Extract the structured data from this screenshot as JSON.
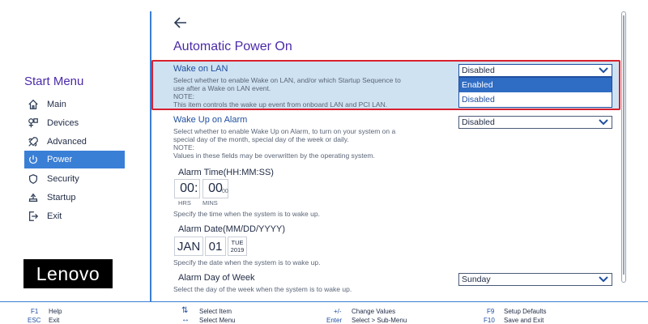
{
  "sidebar": {
    "title": "Start Menu",
    "items": [
      {
        "label": "Main",
        "icon": "home-icon",
        "active": false
      },
      {
        "label": "Devices",
        "icon": "devices-icon",
        "active": false
      },
      {
        "label": "Advanced",
        "icon": "rocket-icon",
        "active": false
      },
      {
        "label": "Power",
        "icon": "power-icon",
        "active": true
      },
      {
        "label": "Security",
        "icon": "shield-icon",
        "active": false
      },
      {
        "label": "Startup",
        "icon": "startup-icon",
        "active": false
      },
      {
        "label": "Exit",
        "icon": "exit-icon",
        "active": false
      }
    ],
    "logo": "Lenovo"
  },
  "page": {
    "title": "Automatic Power On"
  },
  "wake_on_lan": {
    "label": "Wake on LAN",
    "help1": "Select whether to enable Wake on LAN, and/or which Startup Sequence to",
    "help2": "use after a Wake on LAN event.",
    "help3": "NOTE:",
    "help4": "This item controls the wake up event from onboard LAN and PCI LAN.",
    "value": "Disabled",
    "options": [
      "Enabled",
      "Disabled"
    ],
    "highlighted_option": "Enabled"
  },
  "wake_up_on_alarm": {
    "label": "Wake Up on Alarm",
    "help1": "Select whether to enable Wake Up on Alarm, to turn on your system on a",
    "help2": "special day of the month, special day of the week or daily.",
    "help3": "NOTE:",
    "help4": "Values in these fields may be overwritten by the operating system.",
    "value": "Disabled"
  },
  "alarm_time": {
    "label": "Alarm Time(HH:MM:SS)",
    "hours": "00",
    "minutes": "00",
    "seconds": "00",
    "hrs_label": "HRS",
    "mins_label": "MINS",
    "help": "Specify the time when the system is to wake up."
  },
  "alarm_date": {
    "label": "Alarm Date(MM/DD/YYYY)",
    "month": "JAN",
    "day": "01",
    "weekday": "TUE",
    "year": "2019",
    "help": "Specify the date when the system is to wake up."
  },
  "alarm_day_of_week": {
    "label": "Alarm Day of Week",
    "help": "Select the day of the week when the system is to wake up.",
    "value": "Sunday"
  },
  "footer": {
    "f1_key": "F1",
    "f1_desc": "Help",
    "esc_key": "ESC",
    "esc_desc": "Exit",
    "sel_item_key": "⇅",
    "sel_item_desc": "Select Item",
    "sel_menu_key": "↔",
    "sel_menu_desc": "Select Menu",
    "change_key": "+/-",
    "change_desc": "Change Values",
    "enter_key": "Enter",
    "enter_desc": "Select > Sub-Menu",
    "f9_key": "F9",
    "f9_desc": "Setup Defaults",
    "f10_key": "F10",
    "f10_desc": "Save and Exit"
  },
  "colors": {
    "accent": "#3a7fd6",
    "title": "#4b2aa8",
    "highlight_border": "#d8202f",
    "selected_row_bg": "#cfe2f2"
  }
}
